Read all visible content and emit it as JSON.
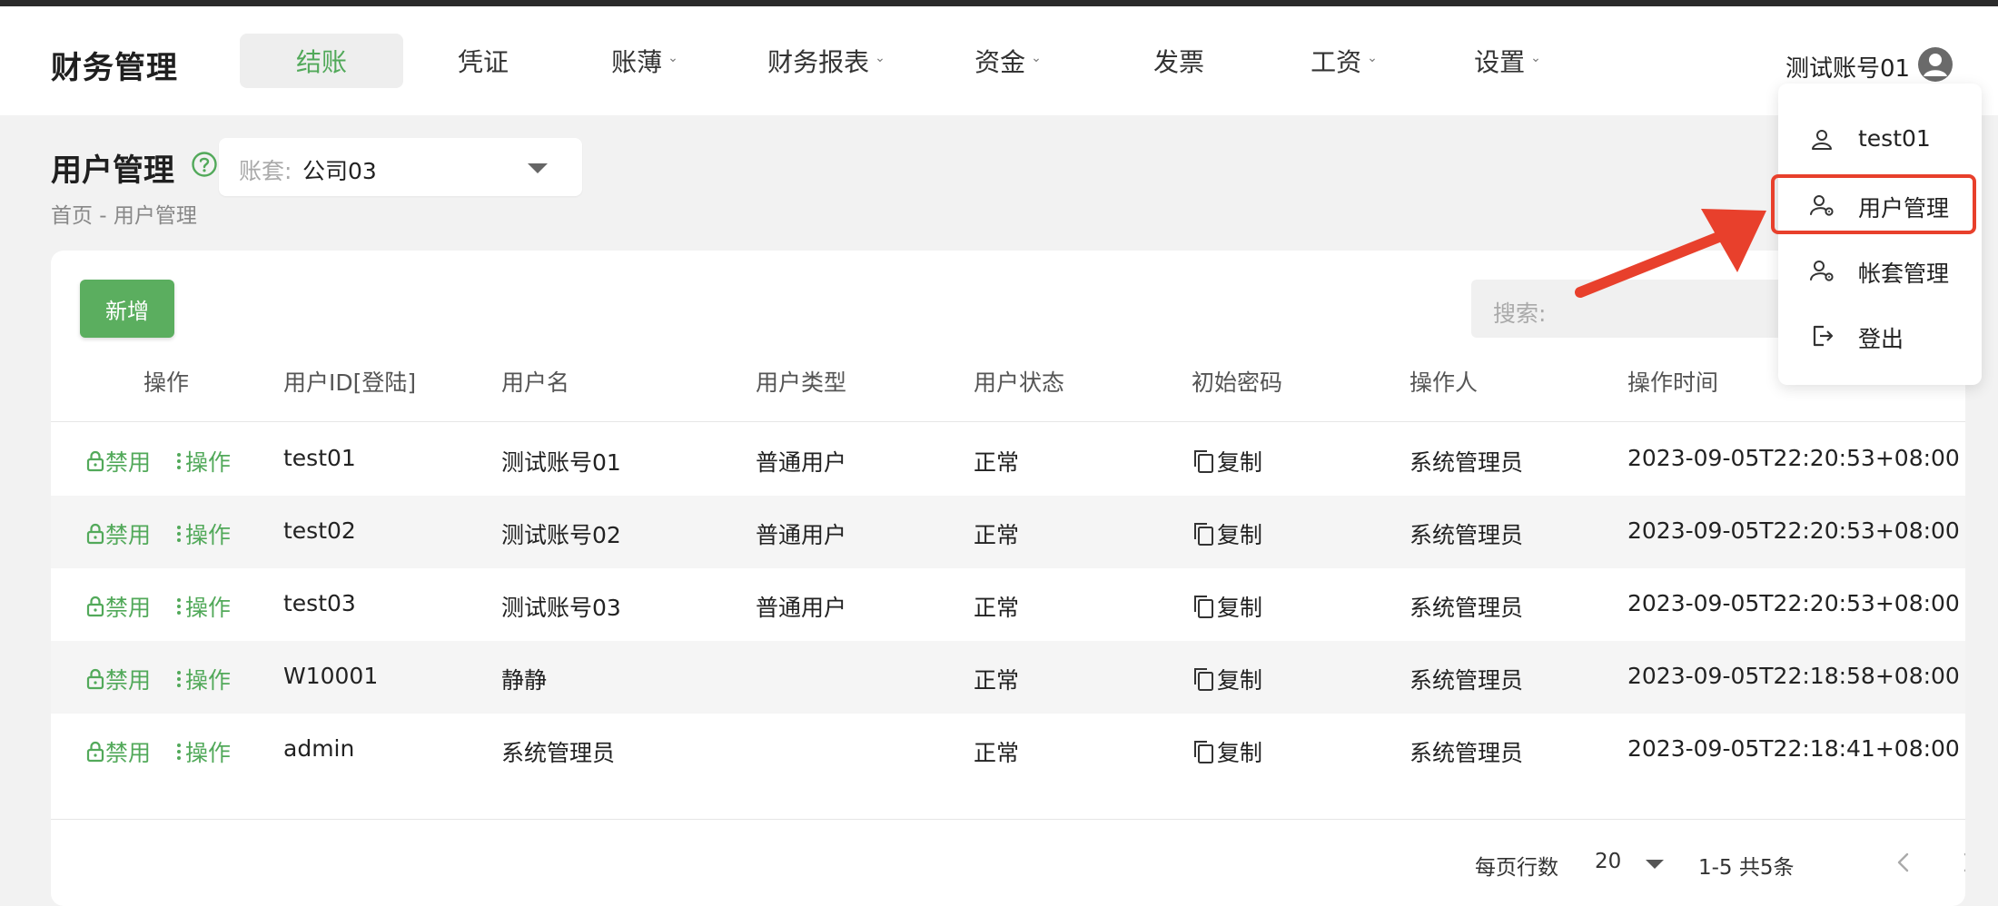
{
  "header": {
    "brand": "财务管理",
    "nav": [
      {
        "label": "结账",
        "active": true,
        "dropdown": false
      },
      {
        "label": "凭证",
        "active": false,
        "dropdown": false
      },
      {
        "label": "账薄",
        "active": false,
        "dropdown": true
      },
      {
        "label": "财务报表",
        "active": false,
        "dropdown": true
      },
      {
        "label": "资金",
        "active": false,
        "dropdown": true
      },
      {
        "label": "发票",
        "active": false,
        "dropdown": false
      },
      {
        "label": "工资",
        "active": false,
        "dropdown": true
      },
      {
        "label": "设置",
        "active": false,
        "dropdown": true
      }
    ],
    "user_name": "测试账号01"
  },
  "page": {
    "title": "用户管理",
    "ledger_label": "账套:",
    "ledger_value": "公司03",
    "breadcrumb": "首页 - 用户管理"
  },
  "toolbar": {
    "add_label": "新增",
    "search_label": "搜索:"
  },
  "table": {
    "headers": [
      "操作",
      "用户ID[登陆]",
      "用户名",
      "用户类型",
      "用户状态",
      "初始密码",
      "操作人",
      "操作时间"
    ],
    "ban_label": "禁用",
    "ops_label": "操作",
    "copy_label": "复制",
    "rows": [
      {
        "id": "test01",
        "name": "测试账号01",
        "type": "普通用户",
        "status": "正常",
        "operator": "系统管理员",
        "time": "2023-09-05T22:20:53+08:00"
      },
      {
        "id": "test02",
        "name": "测试账号02",
        "type": "普通用户",
        "status": "正常",
        "operator": "系统管理员",
        "time": "2023-09-05T22:20:53+08:00"
      },
      {
        "id": "test03",
        "name": "测试账号03",
        "type": "普通用户",
        "status": "正常",
        "operator": "系统管理员",
        "time": "2023-09-05T22:20:53+08:00"
      },
      {
        "id": "W10001",
        "name": "静静",
        "type": "",
        "status": "正常",
        "operator": "系统管理员",
        "time": "2023-09-05T22:18:58+08:00"
      },
      {
        "id": "admin",
        "name": "系统管理员",
        "type": "",
        "status": "正常",
        "operator": "系统管理员",
        "time": "2023-09-05T22:18:41+08:00"
      }
    ]
  },
  "pagination": {
    "rows_per_page_label": "每页行数",
    "rows_per_page": "20",
    "range": "1-5  共5条"
  },
  "user_menu": {
    "items": [
      {
        "label": "test01",
        "icon": "person-icon"
      },
      {
        "label": "用户管理",
        "icon": "user-settings-icon"
      },
      {
        "label": "帐套管理",
        "icon": "account-settings-icon"
      },
      {
        "label": "登出",
        "icon": "logout-icon"
      }
    ],
    "highlighted": "用户管理"
  },
  "colors": {
    "accent": "#52a95a",
    "button": "#5bae5f",
    "annotation": "#e8402c"
  }
}
